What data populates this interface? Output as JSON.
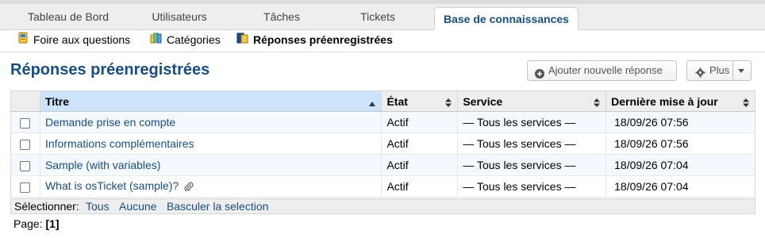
{
  "tabs": [
    {
      "label": "Tableau de Bord"
    },
    {
      "label": "Utilisateurs"
    },
    {
      "label": "Tâches"
    },
    {
      "label": "Tickets"
    },
    {
      "label": "Base de connaissances"
    }
  ],
  "subnav": [
    {
      "label": "Foire aux questions",
      "icon": "faq-icon"
    },
    {
      "label": "Catégories",
      "icon": "categories-icon"
    },
    {
      "label": "Réponses préenregistrées",
      "icon": "canned-responses-icon"
    }
  ],
  "page_title": "Réponses préenregistrées",
  "buttons": {
    "add_label": "Ajouter nouvelle réponse",
    "more_label": "Plus"
  },
  "table": {
    "columns": [
      "Titre",
      "État",
      "Service",
      "Dernière mise à jour"
    ],
    "rows": [
      {
        "title": "Demande prise en compte",
        "state": "Actif",
        "service": "— Tous les services —",
        "updated": "18/09/26 07:56",
        "attachment": false
      },
      {
        "title": "Informations complémentaires",
        "state": "Actif",
        "service": "— Tous les services —",
        "updated": "18/09/26 07:56",
        "attachment": false
      },
      {
        "title": "Sample (with variables)",
        "state": "Actif",
        "service": "— Tous les services —",
        "updated": "18/09/26 07:04",
        "attachment": false
      },
      {
        "title": "What is osTicket (sample)?",
        "state": "Actif",
        "service": "— Tous les services —",
        "updated": "18/09/26 07:04",
        "attachment": true
      }
    ]
  },
  "select": {
    "label": "Sélectionner:",
    "all": "Tous",
    "none": "Aucune",
    "toggle": "Basculer la selection"
  },
  "pager": {
    "label": "Page:",
    "current": "[1]"
  },
  "colors": {
    "accent": "#184e81",
    "sorted_header": "#cbe4fb",
    "odd_row": "#f3f9ff"
  }
}
